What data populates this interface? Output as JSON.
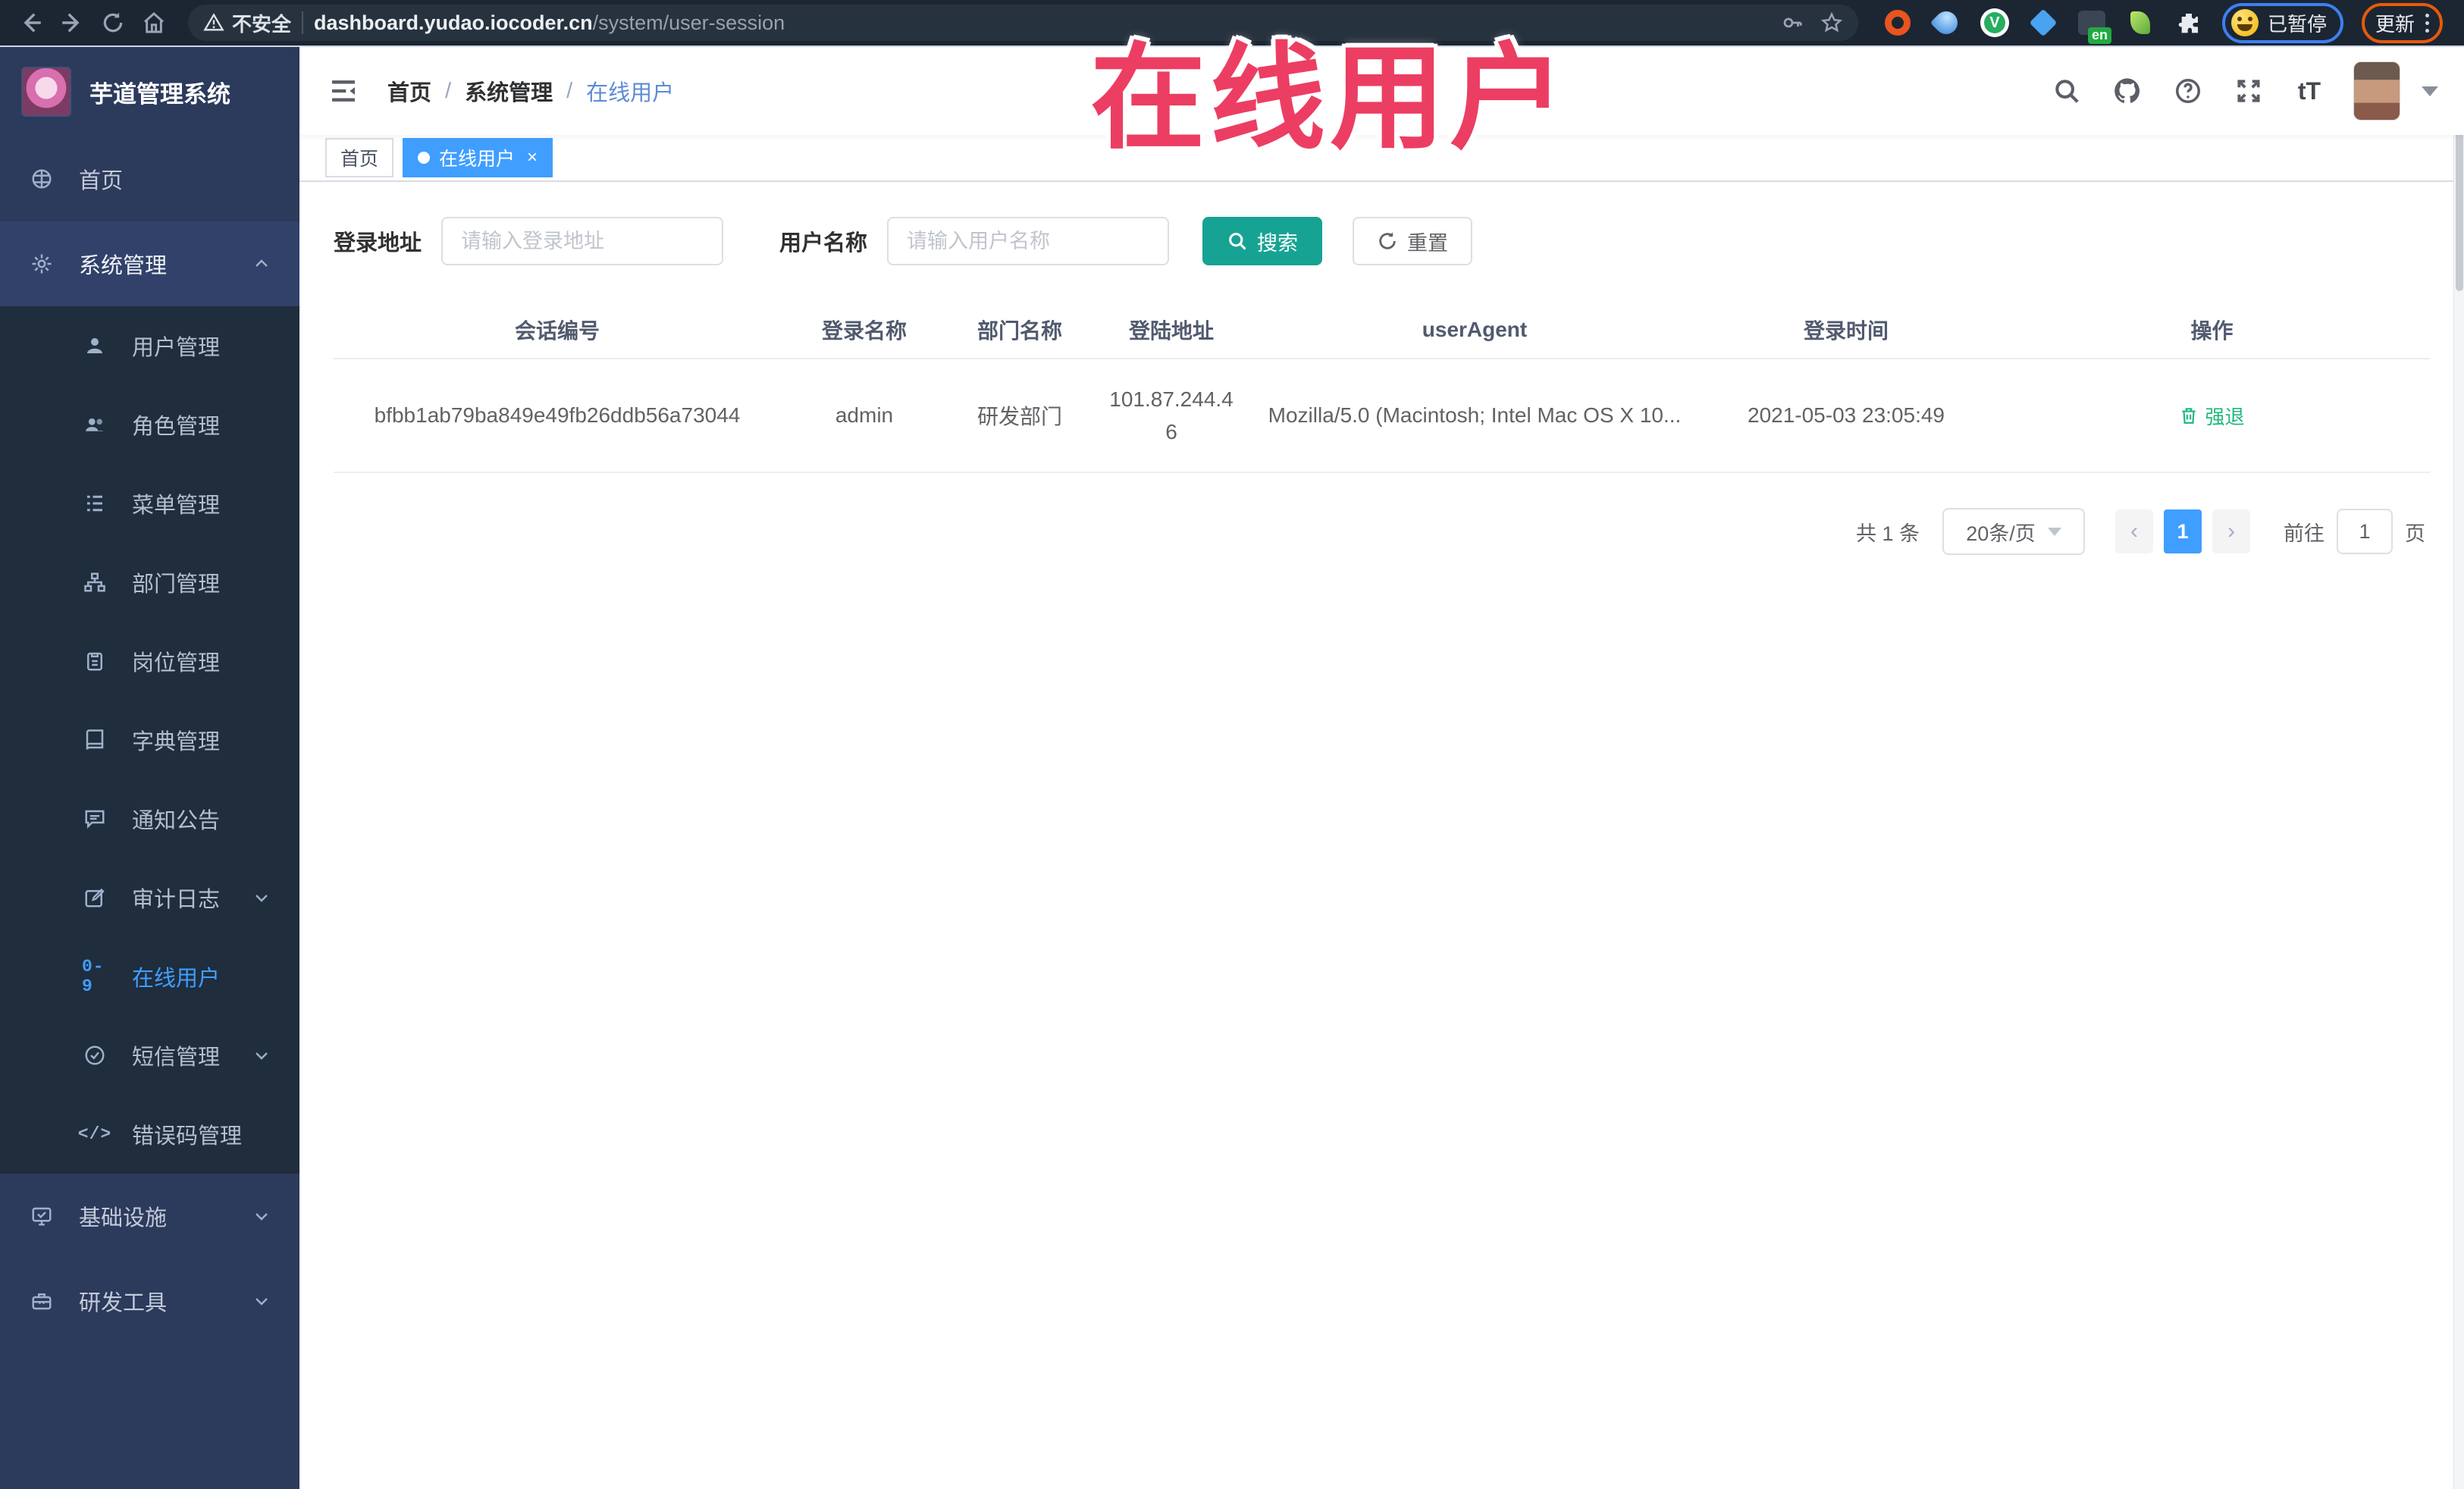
{
  "browser": {
    "security_label": "不安全",
    "url_domain": "dashboard.yudao.iocoder.cn",
    "url_path": "/system/user-session",
    "extension_en_badge": "en",
    "paused_label": "已暂停",
    "update_label": "更新"
  },
  "annotation": {
    "title": "在线用户"
  },
  "sidebar": {
    "logo_title": "芋道管理系统",
    "items": [
      {
        "label": "首页"
      },
      {
        "label": "系统管理"
      },
      {
        "label": "用户管理"
      },
      {
        "label": "角色管理"
      },
      {
        "label": "菜单管理"
      },
      {
        "label": "部门管理"
      },
      {
        "label": "岗位管理"
      },
      {
        "label": "字典管理"
      },
      {
        "label": "通知公告"
      },
      {
        "label": "审计日志"
      },
      {
        "label": "在线用户"
      },
      {
        "label": "短信管理"
      },
      {
        "label": "错误码管理"
      },
      {
        "label": "基础设施"
      },
      {
        "label": "研发工具"
      }
    ],
    "icon_labels": {
      "online": "0-9",
      "errcode": "</>"
    }
  },
  "header": {
    "breadcrumb": {
      "home": "首页",
      "parent": "系统管理",
      "current": "在线用户"
    },
    "font_icon_label": "tT"
  },
  "tags": {
    "home": "首页",
    "current": "在线用户",
    "close": "×"
  },
  "search": {
    "ip_label": "登录地址",
    "ip_placeholder": "请输入登录地址",
    "name_label": "用户名称",
    "name_placeholder": "请输入用户名称",
    "search_button": "搜索",
    "reset_button": "重置"
  },
  "table": {
    "headers": [
      "会话编号",
      "登录名称",
      "部门名称",
      "登陆地址",
      "userAgent",
      "登录时间",
      "操作"
    ],
    "row": {
      "session_id": "bfbb1ab79ba849e49fb26ddb56a73044",
      "username": "admin",
      "department": "研发部门",
      "ip": "101.87.244.46",
      "user_agent": "Mozilla/5.0 (Macintosh; Intel Mac OS X 10...",
      "login_time": "2021-05-03 23:05:49",
      "action": "强退"
    }
  },
  "pagination": {
    "total": "共 1 条",
    "page_size": "20条/页",
    "page": "1",
    "prev": "‹",
    "next": "›",
    "goto_label": "前往",
    "goto_value": "1",
    "page_unit": "页"
  },
  "colors": {
    "accent_blue": "#409EFF",
    "search_teal": "#17A393",
    "sidebar_bg": "#2C3A5C",
    "submenu_bg": "#1F2D3D",
    "annotation_red": "#EC3E62",
    "action_green": "#20B87E"
  }
}
